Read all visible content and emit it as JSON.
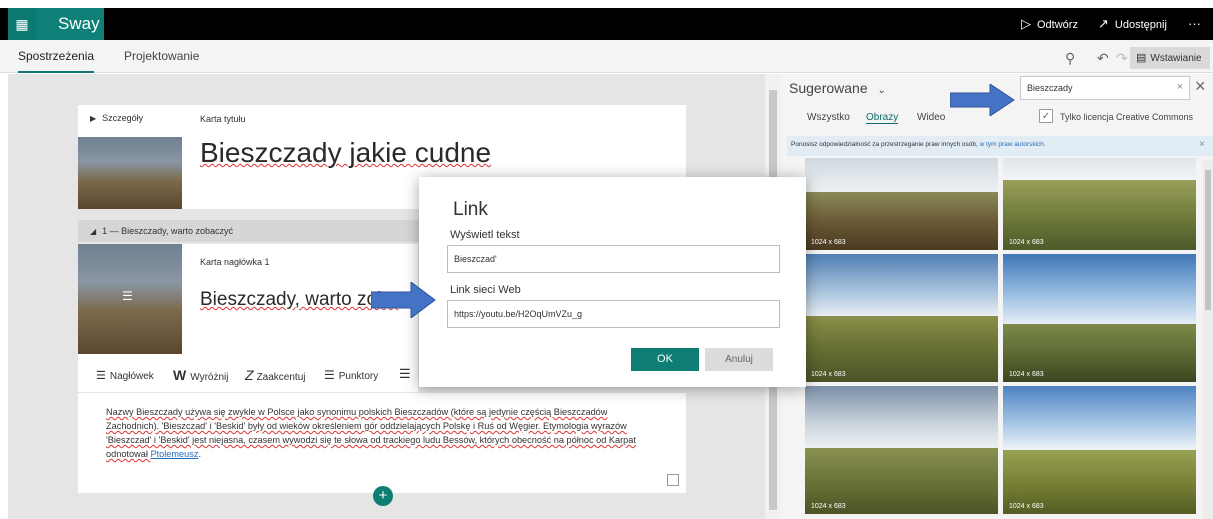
{
  "app": {
    "name": "Sway"
  },
  "topbar": {
    "play_label": "Odtwórz",
    "share_label": "Udostępnij",
    "more_label": "···"
  },
  "tabs": [
    {
      "label": "Spostrzeżenia",
      "active": true
    },
    {
      "label": "Projektowanie",
      "active": false
    }
  ],
  "toolbar": {
    "insert_label": "Wstawianie"
  },
  "storyline": {
    "title_card": {
      "section_label": "Szczegóły",
      "card_label": "Karta tytułu",
      "title": "Bieszczady jakie cudne"
    },
    "section1": {
      "header": "1 — Bieszczady, warto zobaczyć",
      "card_label": "Karta nagłówka 1",
      "heading": "Bieszczady, warto zoba"
    },
    "text_toolbar": {
      "heading_label": "Nagłówek",
      "emphasis_label": "Wyróżnij",
      "accent_label": "Zaakcentuj",
      "bullets_label": "Punktory"
    },
    "paragraph": {
      "line1": "Nazwy Bieszczady używa się zwykle w Polsce jako synonimu polskich Bieszczadów (które są jedynie częścią Bieszczadów",
      "line2": "Zachodnich). 'Bieszczad' i 'Beskid' były od wieków określeniem gór oddzielających Polskę i Ruś od Węgier. Etymologia wyrazów",
      "line3": "'Bieszczad' i 'Beskid' jest niejasna, czasem wywodzi się te słowa od trackiego ludu Bessów, których obecność na północ od Karpat",
      "line4a": "odnotował ",
      "line4b": "Ptolemeusz",
      "line4c": "."
    }
  },
  "dialog": {
    "title": "Link",
    "display_text_label": "Wyświetl tekst",
    "display_text_value": "Bieszczad'",
    "web_link_label": "Link sieci Web",
    "web_link_value": "https://youtu.be/H2OqUmVZu_g",
    "ok_label": "OK",
    "cancel_label": "Anuluj"
  },
  "right_pane": {
    "suggested_label": "Sugerowane",
    "search_value": "Bieszczady",
    "filters": [
      {
        "label": "Wszystko",
        "active": false
      },
      {
        "label": "Obrazy",
        "active": true
      },
      {
        "label": "Wideo",
        "active": false
      }
    ],
    "cc_label": "Tylko licencja Creative Commons",
    "notice_text": "Ponosisz odpowiedzialność za przestrzeganie praw innych osób, ",
    "notice_link": "w tym praw autorskich.",
    "photo_size": "1024 x 683"
  },
  "colors": {
    "accent": "#0e7d74",
    "arrow": "#4472c4"
  }
}
